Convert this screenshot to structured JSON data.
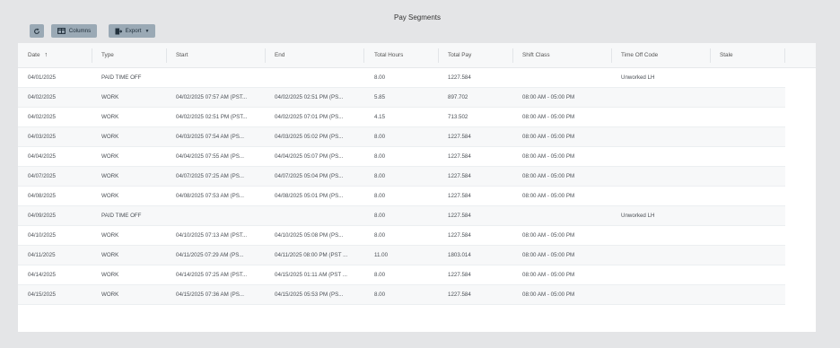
{
  "page_title": "Pay Segments",
  "toolbar": {
    "refresh_icon": "refresh-icon",
    "columns_label": "Columns",
    "columns_icon": "columns-icon",
    "export_label": "Export",
    "export_icon": "export-icon"
  },
  "table": {
    "columns": [
      "Date",
      "Type",
      "Start",
      "End",
      "Total Hours",
      "Total Pay",
      "Shift Class",
      "Time Off Code",
      "Stale"
    ],
    "sort_indicator": "↑",
    "rows": [
      [
        "04/01/2025",
        "PAID TIME OFF",
        "",
        "",
        "8.00",
        "1227.584",
        "",
        "Unworked LH",
        ""
      ],
      [
        "04/02/2025",
        "WORK",
        "04/02/2025 07:57 AM (PST...",
        "04/02/2025 02:51 PM (PS...",
        "5.85",
        "897.702",
        "08:00 AM - 05:00 PM",
        "",
        ""
      ],
      [
        "04/02/2025",
        "WORK",
        "04/02/2025 02:51 PM (PST...",
        "04/02/2025 07:01 PM (PS...",
        "4.15",
        "713.502",
        "08:00 AM - 05:00 PM",
        "",
        ""
      ],
      [
        "04/03/2025",
        "WORK",
        "04/03/2025 07:54 AM (PS...",
        "04/03/2025 05:02 PM (PS...",
        "8.00",
        "1227.584",
        "08:00 AM - 05:00 PM",
        "",
        ""
      ],
      [
        "04/04/2025",
        "WORK",
        "04/04/2025 07:55 AM (PS...",
        "04/04/2025 05:07 PM (PS...",
        "8.00",
        "1227.584",
        "08:00 AM - 05:00 PM",
        "",
        ""
      ],
      [
        "04/07/2025",
        "WORK",
        "04/07/2025 07:25 AM (PS...",
        "04/07/2025 05:04 PM (PS...",
        "8.00",
        "1227.584",
        "08:00 AM - 05:00 PM",
        "",
        ""
      ],
      [
        "04/08/2025",
        "WORK",
        "04/08/2025 07:53 AM (PS...",
        "04/08/2025 05:01 PM (PS...",
        "8.00",
        "1227.584",
        "08:00 AM - 05:00 PM",
        "",
        ""
      ],
      [
        "04/09/2025",
        "PAID TIME OFF",
        "",
        "",
        "8.00",
        "1227.584",
        "",
        "Unworked LH",
        ""
      ],
      [
        "04/10/2025",
        "WORK",
        "04/10/2025 07:13 AM (PST...",
        "04/10/2025 05:08 PM (PS...",
        "8.00",
        "1227.584",
        "08:00 AM - 05:00 PM",
        "",
        ""
      ],
      [
        "04/11/2025",
        "WORK",
        "04/11/2025 07:29 AM (PS...",
        "04/11/2025 08:00 PM (PST ...",
        "11.00",
        "1803.014",
        "08:00 AM - 05:00 PM",
        "",
        ""
      ],
      [
        "04/14/2025",
        "WORK",
        "04/14/2025 07:25 AM (PST...",
        "04/15/2025 01:11 AM (PST ...",
        "8.00",
        "1227.584",
        "08:00 AM - 05:00 PM",
        "",
        ""
      ],
      [
        "04/15/2025",
        "WORK",
        "04/15/2025 07:36 AM (PS...",
        "04/15/2025 05:53 PM (PS...",
        "8.00",
        "1227.584",
        "08:00 AM - 05:00 PM",
        "",
        ""
      ]
    ]
  }
}
